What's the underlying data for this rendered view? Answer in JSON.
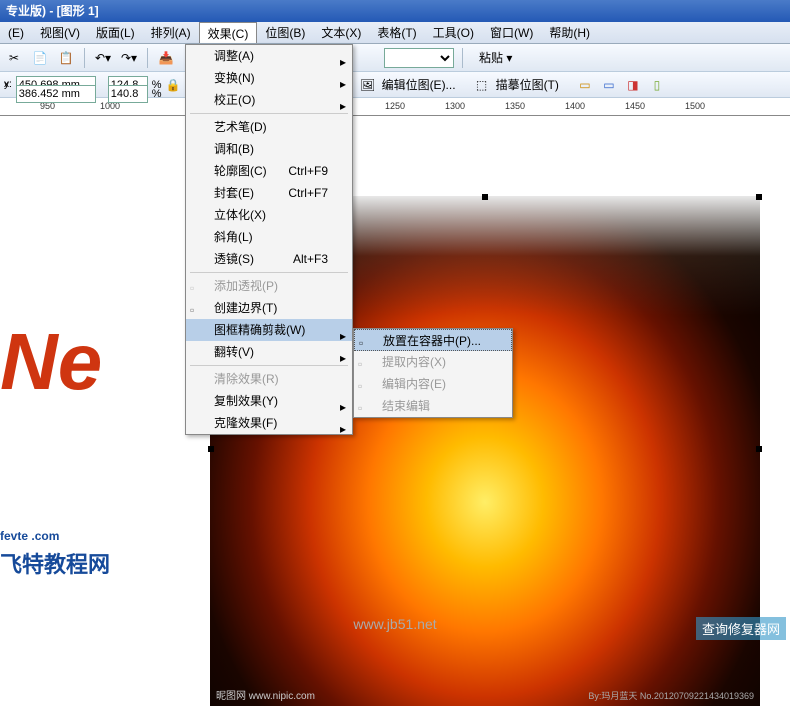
{
  "title": "专业版) - [图形 1]",
  "menu": {
    "items": [
      "(E)",
      "视图(V)",
      "版面(L)",
      "排列(A)",
      "效果(C)",
      "位图(B)",
      "文本(X)",
      "表格(T)",
      "工具(O)",
      "窗口(W)",
      "帮助(H)"
    ]
  },
  "toolbar": {
    "paste": "粘贴 ▾",
    "edit_bitmap": "编辑位图(E)...",
    "trace_bitmap": "描摹位图(T)"
  },
  "coords": {
    "x": "450.698 mm",
    "y": "386.452 mm",
    "w": "124.8",
    "h": "140.8",
    "pct": "%"
  },
  "ruler": [
    "950",
    "1000",
    "1250",
    "1300",
    "1350",
    "1400",
    "1450",
    "1500"
  ],
  "dropdown": [
    {
      "label": "调整(A)",
      "arrow": true
    },
    {
      "label": "变换(N)",
      "arrow": true
    },
    {
      "label": "校正(O)",
      "arrow": true
    },
    {
      "sep": true
    },
    {
      "label": "艺术笔(D)"
    },
    {
      "label": "调和(B)"
    },
    {
      "label": "轮廓图(C)",
      "short": "Ctrl+F9"
    },
    {
      "label": "封套(E)",
      "short": "Ctrl+F7"
    },
    {
      "label": "立体化(X)"
    },
    {
      "label": "斜角(L)"
    },
    {
      "label": "透镜(S)",
      "short": "Alt+F3"
    },
    {
      "sep": true
    },
    {
      "label": "添加透视(P)",
      "disabled": true,
      "icon": true
    },
    {
      "label": "创建边界(T)",
      "icon": true
    },
    {
      "label": "图框精确剪裁(W)",
      "arrow": true,
      "highlight": true
    },
    {
      "label": "翻转(V)",
      "arrow": true
    },
    {
      "sep": true
    },
    {
      "label": "清除效果(R)",
      "disabled": true
    },
    {
      "label": "复制效果(Y)",
      "arrow": true
    },
    {
      "label": "克隆效果(F)",
      "arrow": true
    }
  ],
  "submenu": [
    {
      "label": "放置在容器中(P)...",
      "highlight": true,
      "icon": "container"
    },
    {
      "label": "提取内容(X)",
      "disabled": true,
      "icon": "extract"
    },
    {
      "label": "编辑内容(E)",
      "disabled": true,
      "icon": "edit"
    },
    {
      "label": "结束编辑",
      "disabled": true,
      "icon": "finish"
    }
  ],
  "fire": {
    "bl": "昵图网 www.nipic.com",
    "br": "By:玛月蓝天 No.20120709221434019369"
  },
  "fevte": {
    "l1a": "fevte",
    "l1b": ".com",
    "l2": "飞特教程网"
  },
  "logo_text": "Ne",
  "watermark": "www.jb51.net",
  "corner": "查询修复器网"
}
